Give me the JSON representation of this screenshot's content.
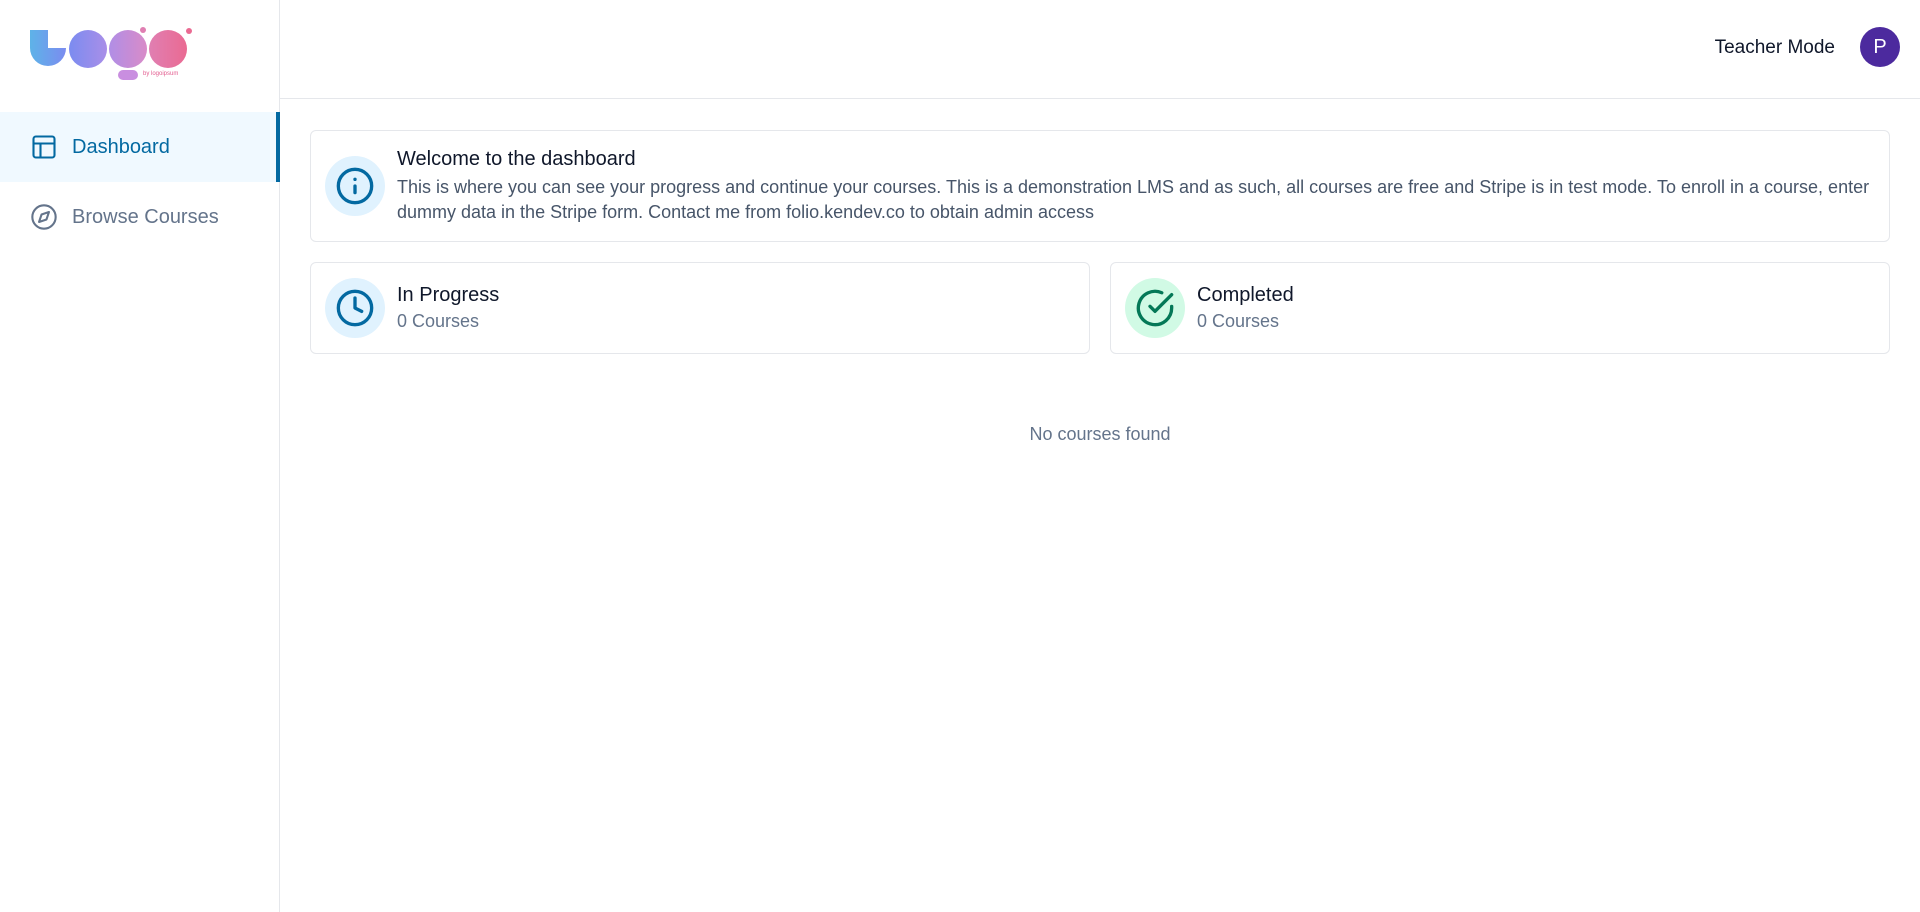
{
  "logo": {
    "caption": "by logoipsum"
  },
  "sidebar": {
    "items": [
      {
        "label": "Dashboard",
        "icon": "layout-icon",
        "active": true
      },
      {
        "label": "Browse Courses",
        "icon": "compass-icon",
        "active": false
      }
    ]
  },
  "header": {
    "teacher_mode_label": "Teacher Mode",
    "avatar_initial": "P"
  },
  "welcome": {
    "title": "Welcome to the dashboard",
    "description": "This is where you can see your progress and continue your courses. This is a demonstration LMS and as such, all courses are free and Stripe is in test mode. To enroll in a course, enter dummy data in the Stripe form. Contact me from folio.kendev.co to obtain admin access"
  },
  "stats": {
    "in_progress": {
      "title": "In Progress",
      "count": "0 Courses"
    },
    "completed": {
      "title": "Completed",
      "count": "0 Courses"
    }
  },
  "empty_state": "No courses found",
  "colors": {
    "accent": "#0369a1",
    "success": "#047857",
    "avatar": "#4c2a9e"
  }
}
